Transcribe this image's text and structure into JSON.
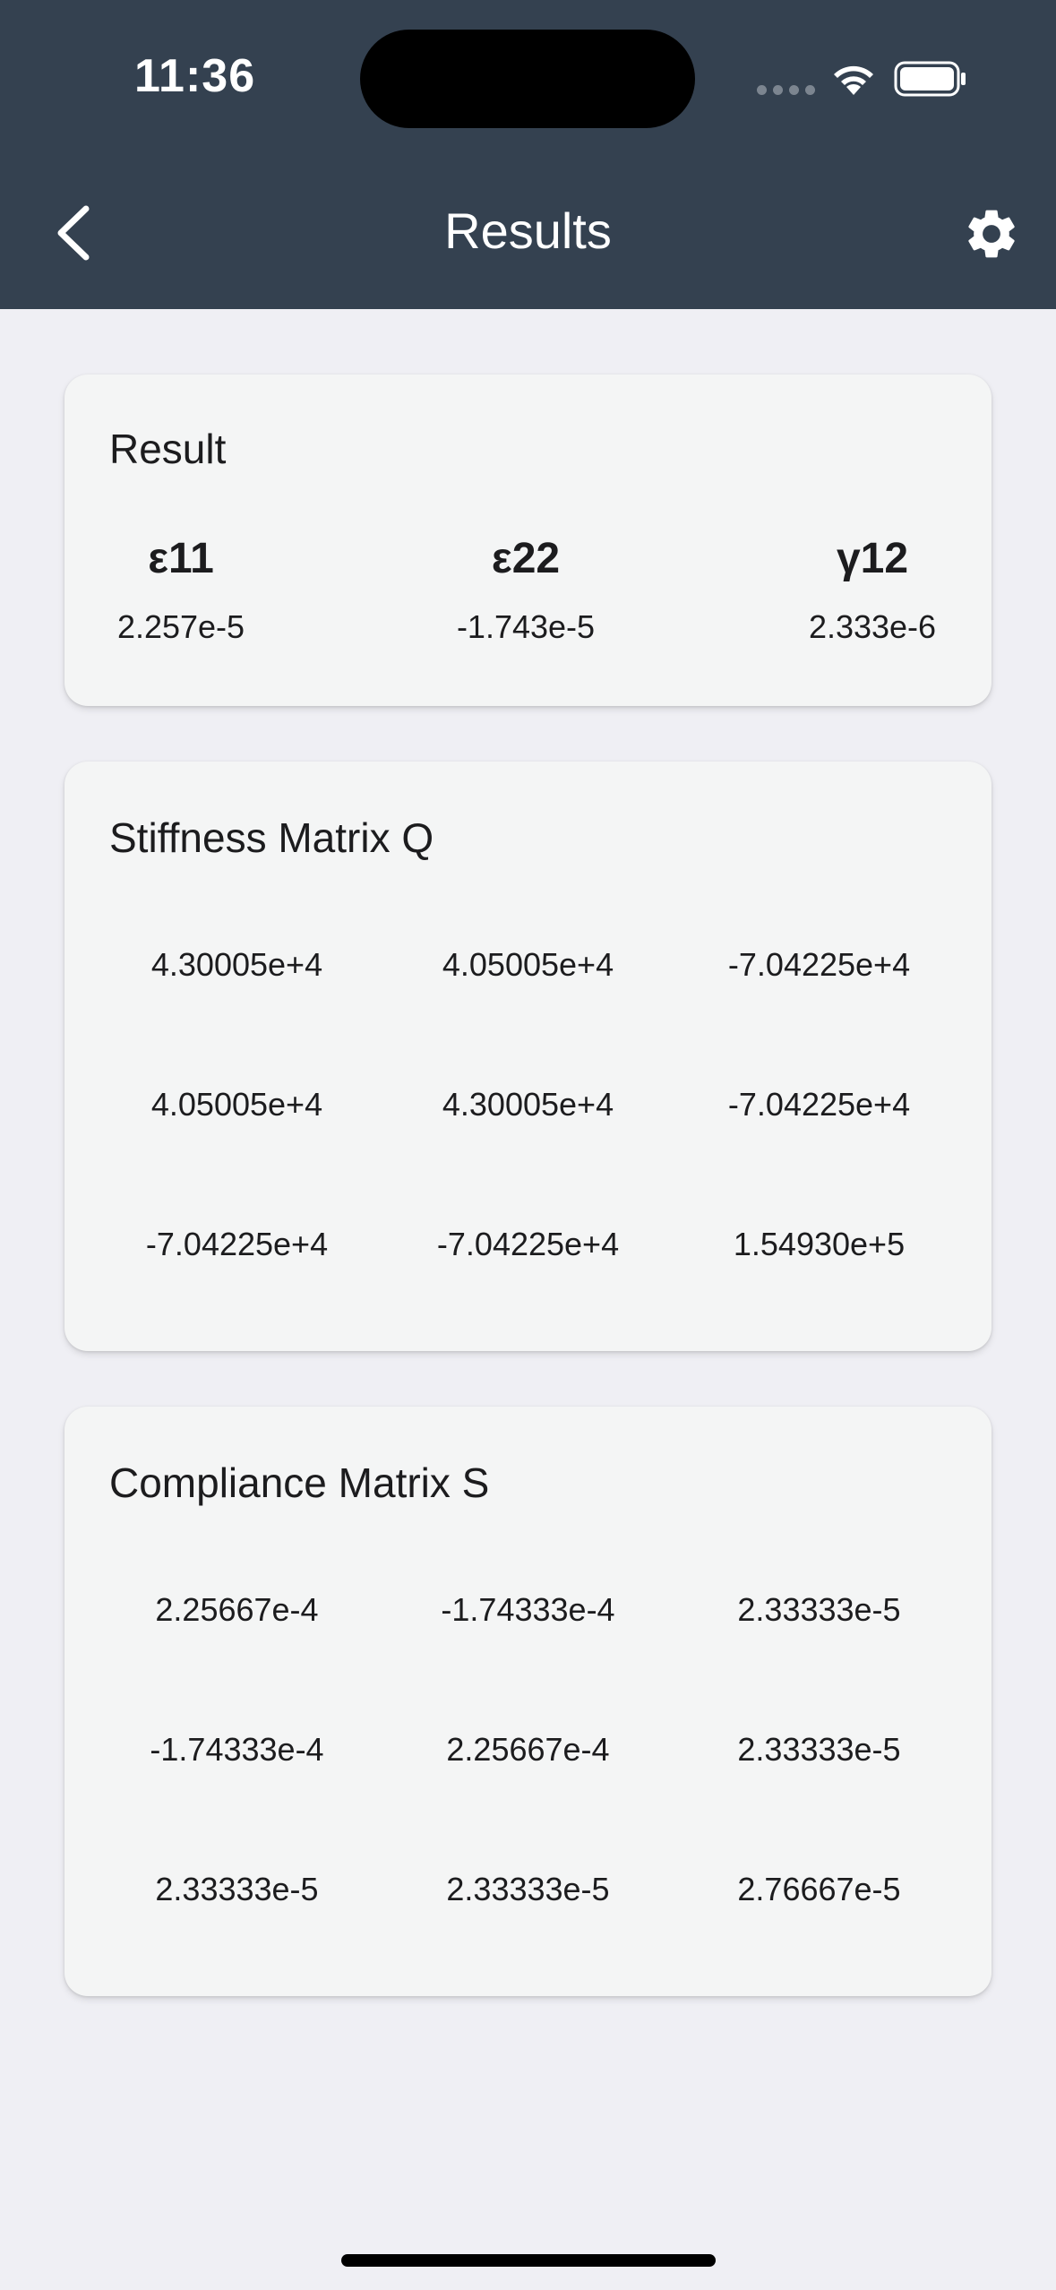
{
  "status_bar": {
    "time": "11:36"
  },
  "nav": {
    "title": "Results",
    "back_icon": "chevron-left-icon",
    "settings_icon": "gear-icon"
  },
  "result": {
    "title": "Result",
    "columns": [
      {
        "label": "ε11",
        "value": "2.257e-5"
      },
      {
        "label": "ε22",
        "value": "-1.743e-5"
      },
      {
        "label": "γ12",
        "value": "2.333e-6"
      }
    ]
  },
  "stiffness": {
    "title": "Stiffness Matrix Q",
    "rows": [
      [
        "4.30005e+4",
        "4.05005e+4",
        "-7.04225e+4"
      ],
      [
        "4.05005e+4",
        "4.30005e+4",
        "-7.04225e+4"
      ],
      [
        "-7.04225e+4",
        "-7.04225e+4",
        "1.54930e+5"
      ]
    ]
  },
  "compliance": {
    "title": "Compliance Matrix S",
    "rows": [
      [
        "2.25667e-4",
        "-1.74333e-4",
        "2.33333e-5"
      ],
      [
        "-1.74333e-4",
        "2.25667e-4",
        "2.33333e-5"
      ],
      [
        "2.33333e-5",
        "2.33333e-5",
        "2.76667e-5"
      ]
    ]
  }
}
